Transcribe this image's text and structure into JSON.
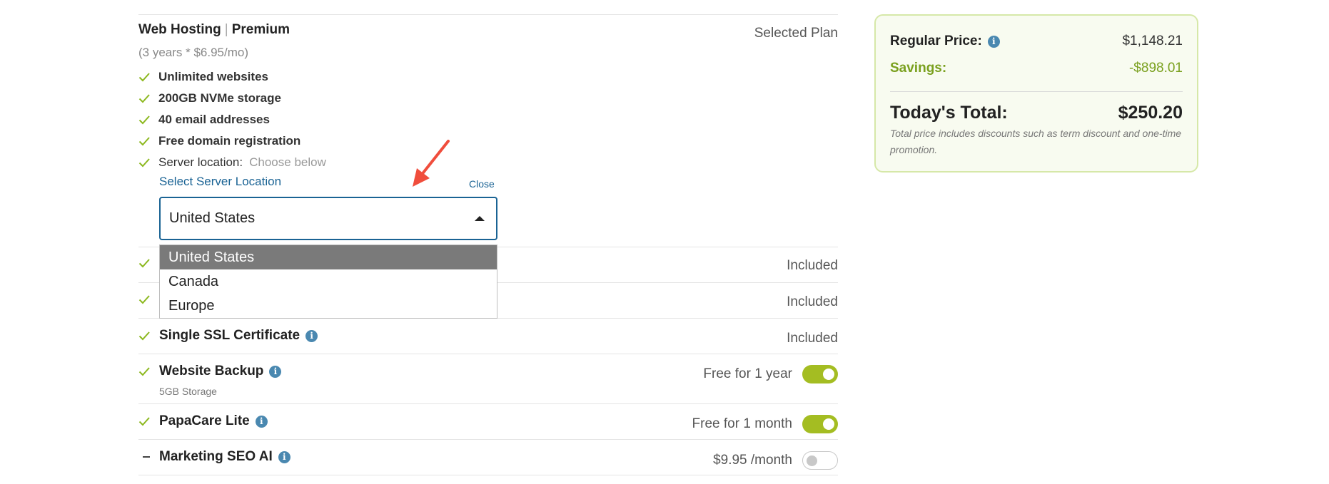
{
  "plan": {
    "name": "Web Hosting",
    "tier": "Premium",
    "separator": "|",
    "term": "(3 years * $6.95/mo)",
    "status": "Selected Plan",
    "features": [
      "Unlimited websites",
      "200GB NVMe storage",
      "40 email addresses",
      "Free domain registration"
    ],
    "server_location_label": "Server location:",
    "server_location_value": "Choose below"
  },
  "location_selector": {
    "label": "Select Server Location",
    "close": "Close",
    "selected": "United States",
    "options": [
      "United States",
      "Canada",
      "Europe"
    ]
  },
  "addons": [
    {
      "name": "",
      "status": "Included"
    },
    {
      "name": "",
      "status": "Included"
    },
    {
      "name": "Single SSL Certificate",
      "status": "Included"
    },
    {
      "name": "Website Backup",
      "sub": "5GB Storage",
      "status": "Free for 1 year",
      "enabled": true
    },
    {
      "name": "PapaCare Lite",
      "status": "Free for 1 month",
      "enabled": true
    },
    {
      "name": "Marketing SEO AI",
      "status": "$9.95 /month",
      "enabled": false
    }
  ],
  "summary": {
    "regular_price_label": "Regular Price:",
    "regular_price": "$1,148.21",
    "savings_label": "Savings:",
    "savings": "-$898.01",
    "total_label": "Today's Total:",
    "total": "$250.20",
    "note": "Total price includes discounts such as term discount and one-time promotion."
  },
  "colors": {
    "accent_blue": "#1a6394",
    "check_green": "#8cb81e",
    "toggle_green": "#a4bd22",
    "summary_border": "#d6e8a8",
    "arrow_red": "#f04d3c"
  },
  "icons": {
    "check": "check-icon",
    "info": "info-icon",
    "caret": "caret-up-icon",
    "arrow": "red-arrow-annotation"
  }
}
